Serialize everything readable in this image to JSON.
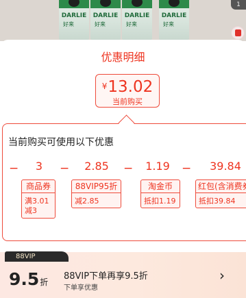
{
  "product_strip": {
    "pack_brand": "DARLIE",
    "pack_cn": "好来",
    "corner_badge": "1"
  },
  "sheet": {
    "title": "优惠明细",
    "price": {
      "currency": "¥",
      "amount": "13.02",
      "caption": "当前购买"
    },
    "callout_title": "当前购买可使用以下优惠",
    "discounts": [
      {
        "sign": "−",
        "value": "3",
        "label": "商品券",
        "detail": "满3.01\n减3"
      },
      {
        "sign": "−",
        "value": "2.85",
        "label": "88VIP95折",
        "detail": "减2.85"
      },
      {
        "sign": "−",
        "value": "1.19",
        "label": "淘金币",
        "detail": "抵扣1.19"
      },
      {
        "sign": "−",
        "value": "39.84",
        "label": "红包(含消费券)",
        "detail": "抵扣39.84"
      }
    ]
  },
  "vip": {
    "label": "88VIP",
    "discount_value": "9.5",
    "discount_unit": "折",
    "headline": "88VIP下单再享9.5折",
    "subline": "下单享优惠",
    "arrow": "›"
  },
  "colors": {
    "accent": "#ee3420"
  }
}
